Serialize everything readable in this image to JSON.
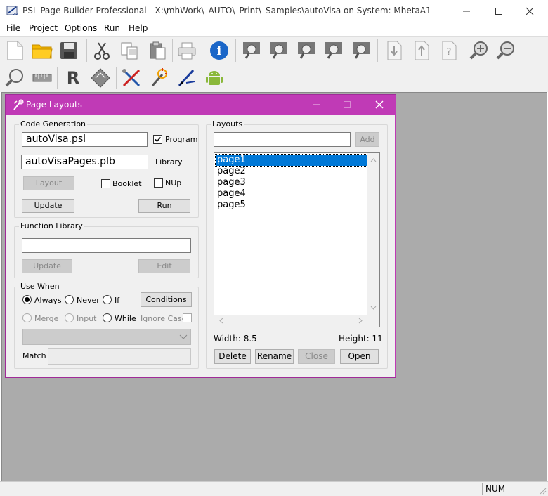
{
  "window": {
    "title": "PSL Page Builder Professional - X:\\mhWork\\_AUTO\\_Print\\_Samples\\autoVisa on System: MhetaA1"
  },
  "menu": [
    "File",
    "Project",
    "Options",
    "Run",
    "Help"
  ],
  "toolbar": {
    "row1": [
      "new-file-icon",
      "open-folder-icon",
      "save-icon",
      "cut-icon",
      "copy-icon",
      "paste-icon",
      "print-icon",
      "info-icon",
      "zoom-page-1-icon",
      "zoom-page-2-icon",
      "zoom-page-3-icon",
      "zoom-page-4-icon",
      "zoom-page-5-icon",
      "move-down-icon",
      "move-up-icon",
      "help-page-icon",
      "zoom-in-icon",
      "zoom-out-icon"
    ],
    "row2": [
      "zoom-icon",
      "ruler-icon",
      "r-icon",
      "diamond-icon",
      "tools-icon",
      "wand-icon",
      "pen-icon",
      "android-icon"
    ],
    "r_label": "R"
  },
  "dialog": {
    "title": "Page Layouts",
    "code_generation": {
      "label": "Code Generation",
      "program_file": "autoVisa.psl",
      "program_checked": true,
      "program_label": "Program",
      "library_file": "autoVisaPages.plb",
      "library_label": "Library",
      "layout_button": "Layout",
      "booklet_label": "Booklet",
      "nup_label": "NUp",
      "update_button": "Update",
      "run_button": "Run"
    },
    "function_library": {
      "label": "Function Library",
      "value": "",
      "update_button": "Update",
      "edit_button": "Edit"
    },
    "use_when": {
      "label": "Use When",
      "always": "Always",
      "never": "Never",
      "if": "If",
      "conditions_button": "Conditions",
      "merge": "Merge",
      "input": "Input",
      "while": "While",
      "ignore_case": "Ignore Case",
      "selected": "Always",
      "match_label": "Match",
      "match_value": ""
    },
    "layouts": {
      "label": "Layouts",
      "new_name": "",
      "add_button": "Add",
      "items": [
        "page1",
        "page2",
        "page3",
        "page4",
        "page5"
      ],
      "selected": "page1",
      "width_label": "Width: 8.5",
      "height_label": "Height: 11",
      "delete_button": "Delete",
      "rename_button": "Rename",
      "close_button": "Close",
      "open_button": "Open"
    }
  },
  "status": {
    "num": "NUM"
  },
  "colors": {
    "dialog_accent": "#c03ab6",
    "selection": "#0078d7",
    "workspace": "#ababab"
  }
}
